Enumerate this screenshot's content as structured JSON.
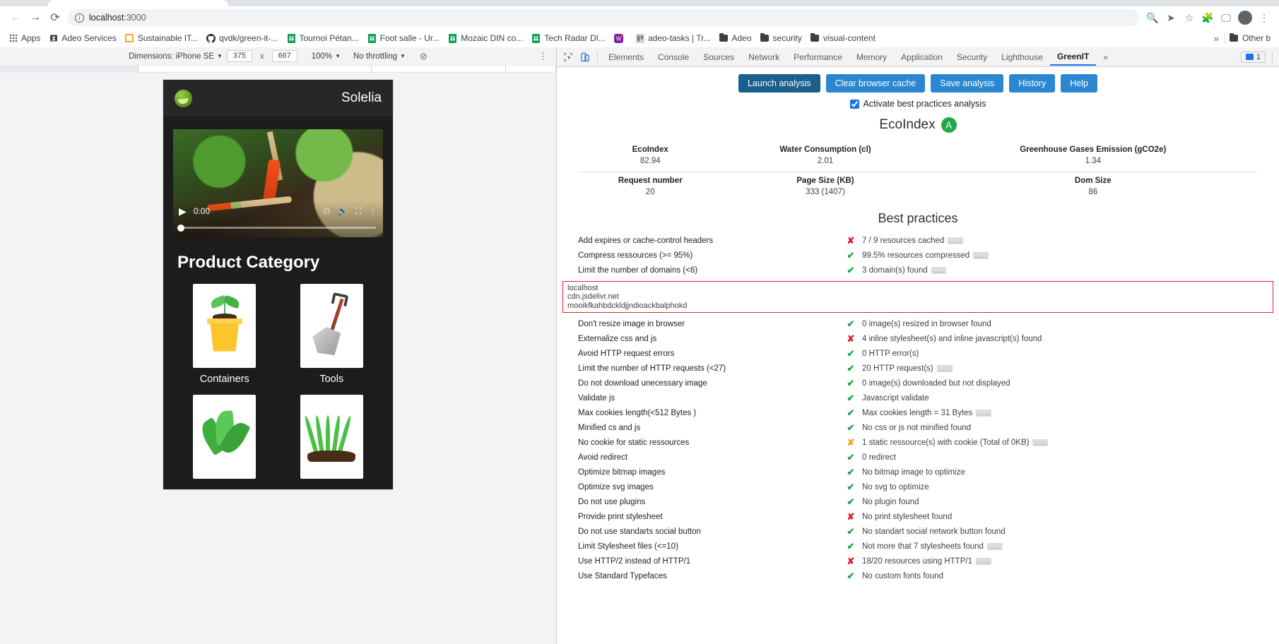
{
  "browser": {
    "url_host": "localhost",
    "url_port": ":3000",
    "back_icon": "back-arrow-icon",
    "forward_icon": "forward-arrow-icon",
    "reload_icon": "reload-icon",
    "info_icon": "site-info-icon",
    "zoom_icon": "zoom-search-icon",
    "share_icon": "share-icon",
    "bookmark_icon": "star-icon",
    "extensions_icon": "puzzle-icon",
    "cast_icon": "cast-icon",
    "menu_icon": "kebab-menu-icon"
  },
  "bookmarks": {
    "apps_label": "Apps",
    "items": [
      {
        "label": "Adeo Services",
        "icon": "contacts-icon",
        "color": "#3c4043"
      },
      {
        "label": "Sustainable IT...",
        "icon": "square-icon",
        "color": "#f5a623"
      },
      {
        "label": "qvdk/green-it-...",
        "icon": "github-icon",
        "color": "#24292e"
      },
      {
        "label": "Tournoi Pétan...",
        "icon": "sheets-icon",
        "color": "#0f9d58"
      },
      {
        "label": "Foot salle - Ur...",
        "icon": "sheets-icon",
        "color": "#0f9d58"
      },
      {
        "label": "Mozaic DIN co...",
        "icon": "sheets-icon",
        "color": "#0f9d58"
      },
      {
        "label": "Tech Radar DI...",
        "icon": "sheets-icon",
        "color": "#0f9d58"
      },
      {
        "label": "",
        "icon": "workplace-icon",
        "color": "#7b1fa2"
      },
      {
        "label": "adeo-tasks | Tr...",
        "icon": "trello-icon",
        "color": "#bdbdbd"
      },
      {
        "label": "Adeo",
        "icon": "folder-icon",
        "color": "#3c4043"
      },
      {
        "label": "security",
        "icon": "folder-icon",
        "color": "#3c4043"
      },
      {
        "label": "visual-content",
        "icon": "folder-icon",
        "color": "#3c4043"
      }
    ],
    "overflow_label": "»",
    "other_label": "Other b"
  },
  "device_toolbar": {
    "dimensions_label": "Dimensions: iPhone SE",
    "width": "375",
    "height": "667",
    "x_separator": "x",
    "zoom": "100%",
    "throttling": "No throttling",
    "rotate_icon": "rotate-icon",
    "more_icon": "kebab-menu-icon"
  },
  "preview": {
    "brand": "Solelia",
    "logo_icon": "solelia-leaf-logo",
    "video": {
      "play_icon": "play-icon",
      "time": "0:00",
      "cast_icon": "cast-icon",
      "volume_icon": "volume-icon",
      "fullscreen_icon": "fullscreen-icon",
      "menu_icon": "kebab-menu-icon"
    },
    "section_title": "Product Category",
    "categories": [
      {
        "label": "Containers",
        "art": "potted-seedling"
      },
      {
        "label": "Tools",
        "art": "shovel"
      },
      {
        "label": "",
        "art": "leaves"
      },
      {
        "label": "",
        "art": "grass"
      }
    ]
  },
  "devtools": {
    "inspect_icon": "inspect-element-icon",
    "device_toggle_icon": "device-toolbar-icon",
    "tabs": [
      "Elements",
      "Console",
      "Sources",
      "Network",
      "Performance",
      "Memory",
      "Application",
      "Security",
      "Lighthouse",
      "GreenIT"
    ],
    "active_tab": "GreenIT",
    "overflow": "»",
    "issues_count": "1",
    "settings_icon": "gear-icon"
  },
  "greenit": {
    "buttons": [
      {
        "label": "Launch analysis",
        "style": "primary"
      },
      {
        "label": "Clear browser cache",
        "style": "secondary"
      },
      {
        "label": "Save analysis",
        "style": "secondary"
      },
      {
        "label": "History",
        "style": "secondary"
      },
      {
        "label": "Help",
        "style": "secondary"
      }
    ],
    "checkbox_label": "Activate best practices analysis",
    "checkbox_checked": true,
    "ecoindex_title": "EcoIndex",
    "grade": "A",
    "grade_color": "#22a84a",
    "metrics_row1": [
      {
        "header": "EcoIndex",
        "value": "82.94"
      },
      {
        "header": "Water Consumption (cl)",
        "value": "2.01"
      },
      {
        "header": "Greenhouse Gases Emission (gCO2e)",
        "value": "1.34"
      }
    ],
    "metrics_row2": [
      {
        "header": "Request number",
        "value": "20"
      },
      {
        "header": "Page Size (KB)",
        "value": "333 (1407)"
      },
      {
        "header": "Dom Size",
        "value": "86"
      }
    ],
    "best_practices_title": "Best practices",
    "rules": [
      {
        "name": "Add expires or cache-control headers",
        "status": "ko",
        "value": "7 / 9 resources cached",
        "dots": true
      },
      {
        "name": "Compress ressources (>= 95%)",
        "status": "ok",
        "value": "99.5% resources compressed",
        "dots": true
      },
      {
        "name": "Limit the number of domains (<6)",
        "status": "ok",
        "value": "3 domain(s) found",
        "dots": true
      },
      {
        "name": "Don't resize image in browser",
        "status": "ok",
        "value": "0 image(s) resized in browser found",
        "dots": false
      },
      {
        "name": "Externalize css and js",
        "status": "ko",
        "value": "4 inline stylesheet(s) and inline javascript(s) found",
        "dots": false
      },
      {
        "name": "Avoid HTTP request errors",
        "status": "ok",
        "value": "0 HTTP error(s)",
        "dots": false
      },
      {
        "name": "Limit the number of HTTP requests (<27)",
        "status": "ok",
        "value": "20 HTTP request(s)",
        "dots": true
      },
      {
        "name": "Do not download unecessary image",
        "status": "ok",
        "value": "0 image(s) downloaded but not displayed",
        "dots": false
      },
      {
        "name": "Validate js",
        "status": "ok",
        "value": "Javascript validate",
        "dots": false
      },
      {
        "name": "Max cookies length(<512 Bytes )",
        "status": "ok",
        "value": "Max cookies length = 31 Bytes",
        "dots": true
      },
      {
        "name": "Minified cs and js",
        "status": "ok",
        "value": "No css or js not minified found",
        "dots": false
      },
      {
        "name": "No cookie for static ressources",
        "status": "warn",
        "value": "1 static ressource(s) with cookie (Total of 0KB)",
        "dots": true
      },
      {
        "name": "Avoid redirect",
        "status": "ok",
        "value": "0 redirect",
        "dots": false
      },
      {
        "name": "Optimize bitmap images",
        "status": "ok",
        "value": "No bitmap image to optimize",
        "dots": false
      },
      {
        "name": "Optimize svg images",
        "status": "ok",
        "value": "No svg to optimize",
        "dots": false
      },
      {
        "name": "Do not use plugins",
        "status": "ok",
        "value": "No plugin found",
        "dots": false
      },
      {
        "name": "Provide print stylesheet",
        "status": "ko",
        "value": "No print stylesheet found",
        "dots": false
      },
      {
        "name": "Do not use standarts social button",
        "status": "ok",
        "value": "No standart social network button found",
        "dots": false
      },
      {
        "name": "Limit Stylesheet files (<=10)",
        "status": "ok",
        "value": "Not more that 7 stylesheets found",
        "dots": true
      },
      {
        "name": "Use HTTP/2 instead of HTTP/1",
        "status": "ko",
        "value": "18/20 resources using HTTP/1",
        "dots": true
      },
      {
        "name": "Use Standard Typefaces",
        "status": "ok",
        "value": "No custom fonts found",
        "dots": false
      }
    ],
    "expanded_after_rule_index": 2,
    "domain_list": [
      "localhost",
      "cdn.jsdelivr.net",
      "mooikfkahbdckldjjndioackbalphokd"
    ],
    "marks": {
      "ok": "✔",
      "ko": "✘",
      "warn": "✘"
    }
  }
}
